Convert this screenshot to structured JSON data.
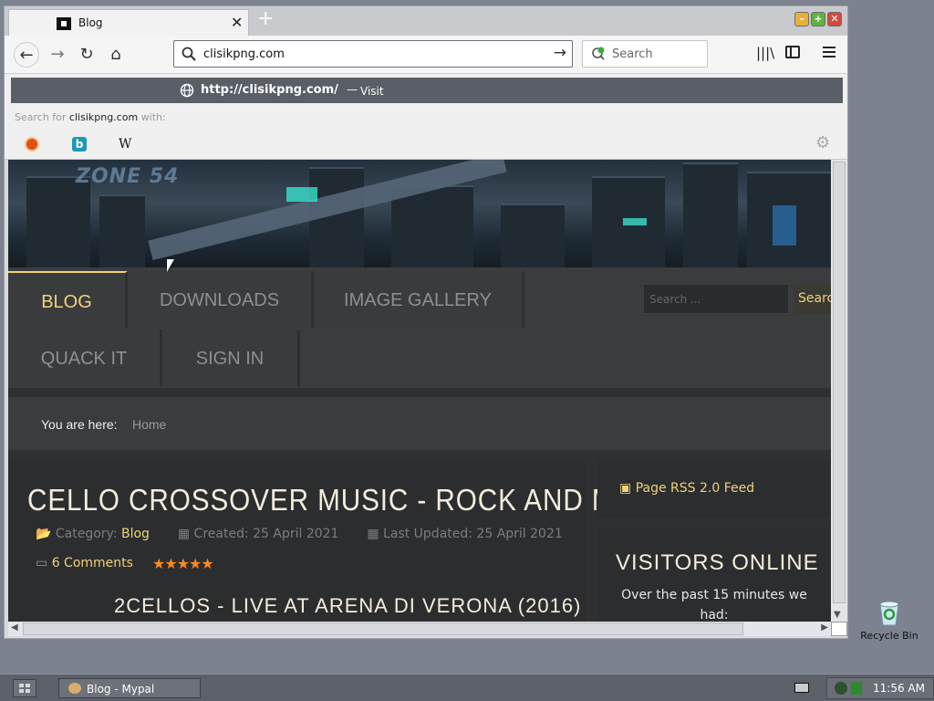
{
  "desktop": {
    "recycle_bin_label": "Recycle Bin"
  },
  "tab": {
    "title": "Blog",
    "close_glyph": "✕",
    "new_tab_glyph": "+"
  },
  "window_controls": {
    "minimize": "–",
    "maximize": "+",
    "close": "✕"
  },
  "toolbar": {
    "url_value": "clisikpng.com",
    "search_placeholder": "Search",
    "back_glyph": "←",
    "forward_glyph": "→",
    "reload_glyph": "↻",
    "home_glyph": "⌂",
    "go_glyph": "→",
    "library_glyph": "|||\\"
  },
  "url_dropdown": {
    "visit_url": "http://clisikpng.com/",
    "visit_separator": "—",
    "visit_label": "Visit",
    "search_for_prefix": "Search for",
    "search_for_term": "clisikpng.com",
    "search_for_suffix": "with:",
    "engines": [
      "duckduckgo-icon",
      "bing-icon",
      "wikipedia-icon"
    ],
    "wiki_glyph": "W",
    "bing_glyph": "b",
    "settings_glyph": "⚙"
  },
  "page": {
    "logo_text": "ZONE 54",
    "menu": [
      "BLOG",
      "DOWNLOADS",
      "IMAGE GALLERY",
      "QUACK IT",
      "SIGN IN"
    ],
    "active_menu": "BLOG",
    "site_search_placeholder": "Search ...",
    "site_search_button": "Search",
    "breadcrumb_label": "You are here:",
    "breadcrumb_home": "Home",
    "article": {
      "title": "CELLO CROSSOVER MUSIC - ROCK AND METAL",
      "category_label": "Category:",
      "category_value": "Blog",
      "created": "Created: 25 April 2021",
      "updated": "Last Updated: 25 April 2021",
      "comments": "6 Comments",
      "rating_stars": 5,
      "video_title": "2CELLOS - LIVE AT ARENA DI VERONA (2016)"
    },
    "rss_link": "Page RSS 2.0 Feed",
    "visitors_title": "VISITORS ONLINE",
    "visitors_text": "Over the past 15 minutes we had:"
  },
  "taskbar": {
    "task_label": "Blog - Mypal",
    "clock": "11:56 AM"
  },
  "colors": {
    "accent": "#f0d27a",
    "star": "#ff8a1c",
    "menu_bg": "#3a3b3d"
  }
}
